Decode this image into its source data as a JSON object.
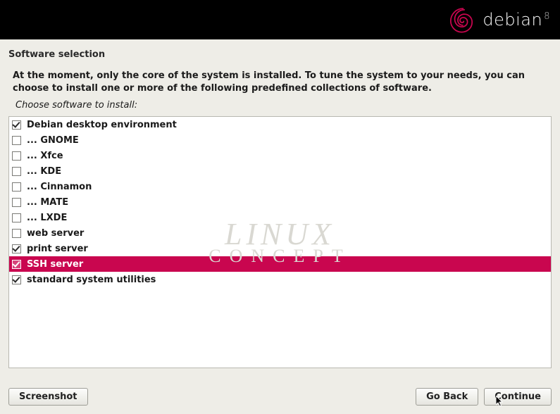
{
  "brand": {
    "name": "debian",
    "version": "8"
  },
  "title": "Software selection",
  "intro_text": "At the moment, only the core of the system is installed. To tune the system to your needs, you can choose to install one or more of the following predefined collections of software.",
  "sub_intro": "Choose software to install:",
  "watermark": {
    "line1": "LINUX",
    "line2": "CONCEPT"
  },
  "options": [
    {
      "label": "Debian desktop environment",
      "checked": true,
      "selected": false
    },
    {
      "label": "... GNOME",
      "checked": false,
      "selected": false
    },
    {
      "label": "... Xfce",
      "checked": false,
      "selected": false
    },
    {
      "label": "... KDE",
      "checked": false,
      "selected": false
    },
    {
      "label": "... Cinnamon",
      "checked": false,
      "selected": false
    },
    {
      "label": "... MATE",
      "checked": false,
      "selected": false
    },
    {
      "label": "... LXDE",
      "checked": false,
      "selected": false
    },
    {
      "label": "web server",
      "checked": false,
      "selected": false
    },
    {
      "label": "print server",
      "checked": true,
      "selected": false
    },
    {
      "label": "SSH server",
      "checked": true,
      "selected": true
    },
    {
      "label": "standard system utilities",
      "checked": true,
      "selected": false
    }
  ],
  "buttons": {
    "screenshot": "Screenshot",
    "go_back": "Go Back",
    "continue": "Continue"
  }
}
